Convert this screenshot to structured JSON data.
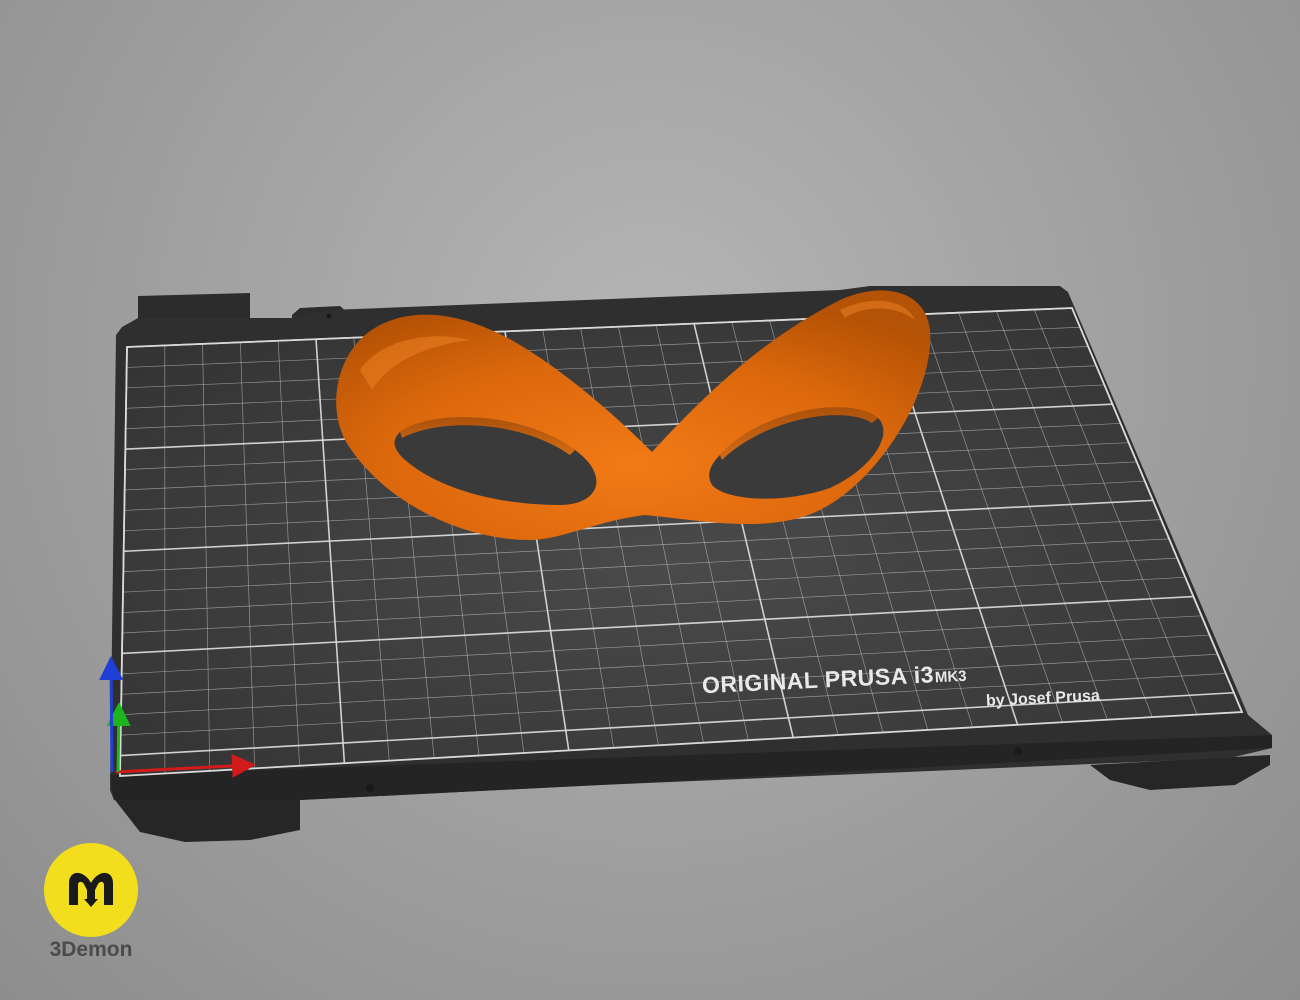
{
  "bed": {
    "brand_line": "ORIGINAL PRUSA i3",
    "model": "MK3",
    "byline": "by Josef Prusa"
  },
  "model_object": {
    "name": "mask",
    "color": "#e06a0c"
  },
  "axes": {
    "x_color": "#d11a1a",
    "y_color": "#1db51d",
    "z_color": "#1f3fd6"
  },
  "watermark": {
    "logo_letter": "m",
    "name": "3Demon",
    "badge_color": "#f2de1c"
  },
  "colors": {
    "background": "#a3a3a3",
    "bed_frame": "#2e2e2e",
    "bed_surface": "#3a3a3a",
    "grid_line": "#d9d9d9"
  }
}
